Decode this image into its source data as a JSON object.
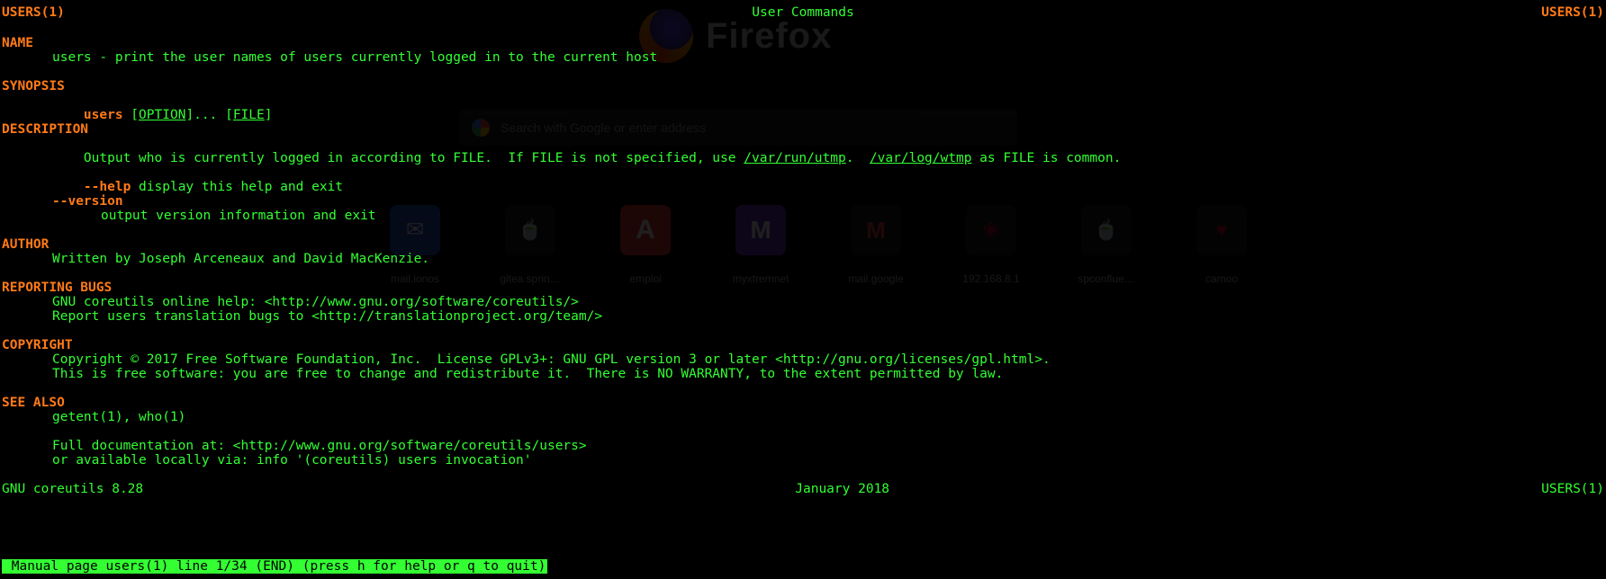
{
  "header": {
    "left": "USERS(1)",
    "center": "User Commands",
    "right": "USERS(1)"
  },
  "sections": {
    "name": {
      "heading": "NAME",
      "body": "users - print the user names of users currently logged in to the current host"
    },
    "synopsis": {
      "heading": "SYNOPSIS",
      "cmd": "users",
      "opt": "OPTION",
      "file": "FILE"
    },
    "description": {
      "heading": "DESCRIPTION",
      "line1_a": "Output who is currently logged in according to FILE.  If FILE is not specified, use ",
      "utmp": "/var/run/utmp",
      "line1_b": ".  ",
      "wtmp": "/var/log/wtmp",
      "line1_c": " as FILE is common.",
      "help_flag": "--help",
      "help_text": " display this help and exit",
      "version_flag": "--version",
      "version_text": "output version information and exit"
    },
    "author": {
      "heading": "AUTHOR",
      "body": "Written by Joseph Arceneaux and David MacKenzie."
    },
    "bugs": {
      "heading": "REPORTING BUGS",
      "l1": "GNU coreutils online help: <http://www.gnu.org/software/coreutils/>",
      "l2": "Report users translation bugs to <http://translationproject.org/team/>"
    },
    "copyright": {
      "heading": "COPYRIGHT",
      "l1": "Copyright © 2017 Free Software Foundation, Inc.  License GPLv3+: GNU GPL version 3 or later <http://gnu.org/licenses/gpl.html>.",
      "l2": "This is free software: you are free to change and redistribute it.  There is NO WARRANTY, to the extent permitted by law."
    },
    "see_also": {
      "heading": "SEE ALSO",
      "l1": "getent(1), who(1)",
      "l2": "Full documentation at: <http://www.gnu.org/software/coreutils/users>",
      "l3": "or available locally via: info '(coreutils) users invocation'"
    }
  },
  "footer": {
    "left": "GNU coreutils 8.28",
    "center": "January 2018",
    "right": "USERS(1)"
  },
  "status_line": " Manual page users(1) line 1/34 (END) (press h for help or q to quit)",
  "firefox": {
    "brand": "Firefox",
    "search_placeholder": "Search with Google or enter address",
    "tiles": [
      {
        "label": "mail.ionos",
        "cls": "t-ionos"
      },
      {
        "label": "gitea.sprin…",
        "cls": "t-gitea"
      },
      {
        "label": "emploi",
        "cls": "t-emploi"
      },
      {
        "label": "myxtremnet",
        "cls": "t-myx"
      },
      {
        "label": "mail.google",
        "cls": "t-gmail"
      },
      {
        "label": "192.168.8.1",
        "cls": "t-router"
      },
      {
        "label": "spconflue…",
        "cls": "t-conf"
      },
      {
        "label": "camoo",
        "cls": "t-camoo"
      }
    ]
  }
}
